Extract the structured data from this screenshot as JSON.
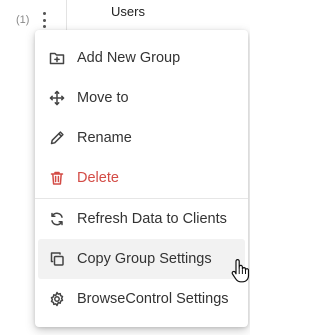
{
  "background": {
    "count_label": "(1)",
    "column_title": "Users"
  },
  "menu": {
    "items": [
      {
        "label": "Add New Group",
        "icon": "folder-plus-icon"
      },
      {
        "label": "Move to",
        "icon": "move-arrows-icon"
      },
      {
        "label": "Rename",
        "icon": "pencil-icon"
      },
      {
        "label": "Delete",
        "icon": "trash-icon",
        "color": "#d34b45"
      },
      {
        "label": "Refresh Data to Clients",
        "icon": "refresh-icon"
      },
      {
        "label": "Copy Group Settings",
        "icon": "copy-icon",
        "state": "hover"
      },
      {
        "label": "BrowseControl Settings",
        "icon": "gear-icon"
      }
    ]
  },
  "colors": {
    "danger": "#d34b45",
    "hover_bg": "#f2f2f2"
  }
}
